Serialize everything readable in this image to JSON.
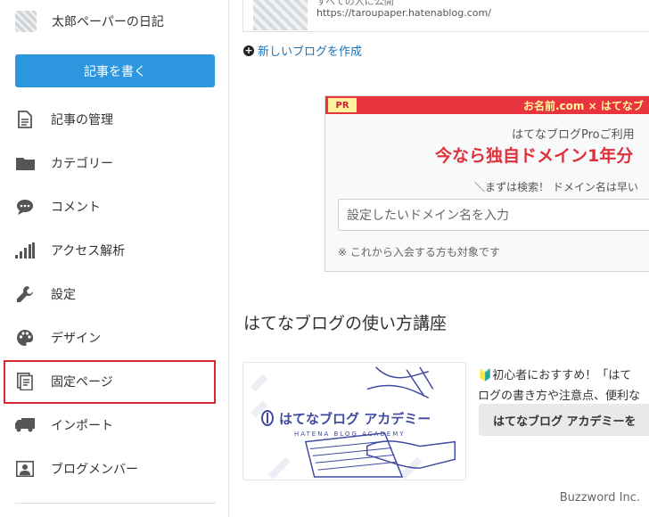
{
  "sidebar": {
    "blog_name": "太郎ペーパーの日記",
    "write_button": "記事を書く",
    "items": [
      {
        "label": "記事の管理",
        "icon": "document-icon"
      },
      {
        "label": "カテゴリー",
        "icon": "folder-icon"
      },
      {
        "label": "コメント",
        "icon": "comment-icon"
      },
      {
        "label": "アクセス解析",
        "icon": "bar-chart-icon"
      },
      {
        "label": "設定",
        "icon": "wrench-icon"
      },
      {
        "label": "デザイン",
        "icon": "palette-icon"
      },
      {
        "label": "固定ページ",
        "icon": "pages-icon",
        "selected": true
      },
      {
        "label": "インポート",
        "icon": "truck-icon"
      },
      {
        "label": "ブログメンバー",
        "icon": "member-icon"
      }
    ]
  },
  "blog_card": {
    "visibility": "すべての人に公開",
    "url": "https://taroupaper.hatenablog.com/"
  },
  "new_blog_link": "新しいブログを作成",
  "ad": {
    "tag": "PR",
    "brand": "お名前.com × はてなブ",
    "line1": "はてなブログProご利用",
    "headline": "今なら独自ドメイン1年分",
    "line2": "＼まずは検索！ ドメイン名は早い",
    "input_placeholder": "設定したいドメイン名を入力",
    "note": "※ これから入会する方も対象です"
  },
  "academy": {
    "section_title": "はてなブログの使い方講座",
    "image_title": "はてなブログ アカデミー",
    "image_subtitle": "HATENA BLOG ACADEMY",
    "line1_mark": "🔰",
    "line1": "初心者におすすめ！「はて",
    "line2": "ログの書き方や注意点、便利な",
    "button": "はてなブログ アカデミーを"
  },
  "watermark": "Buzzword Inc.",
  "colors": {
    "primary": "#2c97de",
    "selected_outline": "#d9282f",
    "ad_bar": "#e8343f",
    "link": "#1a73b8"
  }
}
